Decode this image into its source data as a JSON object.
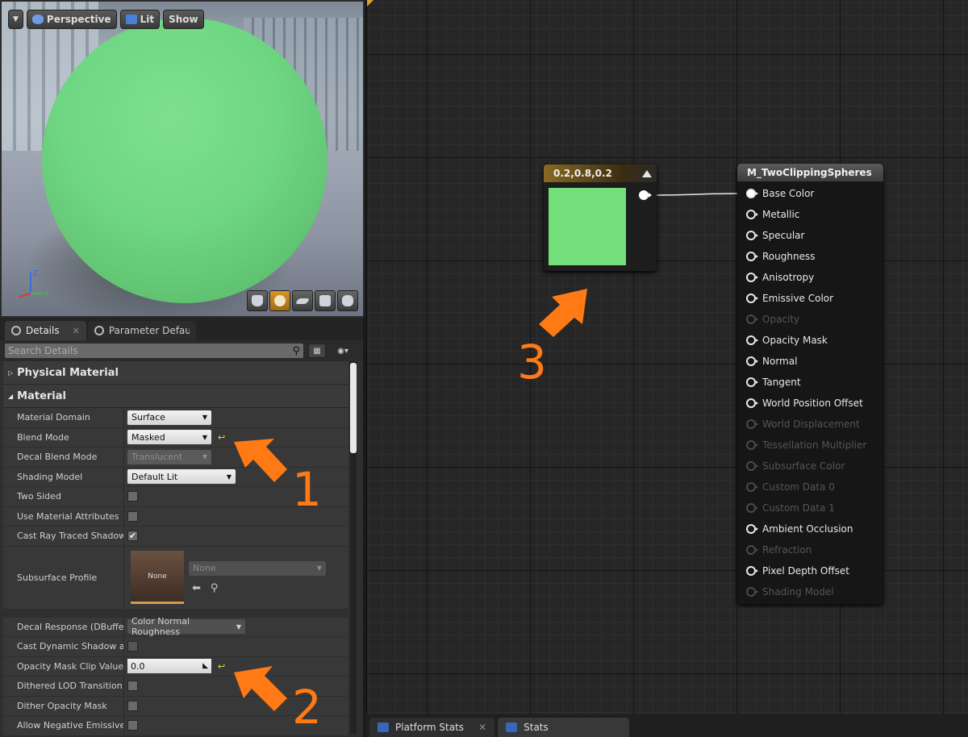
{
  "viewport": {
    "menu_icon": "chevron-down-icon",
    "perspective_label": "Perspective",
    "lit_label": "Lit",
    "show_label": "Show",
    "axis_z": "Z",
    "axis_y": "Y",
    "preview_color": "#6fd682"
  },
  "details": {
    "tabs": [
      {
        "label": "Details"
      },
      {
        "label": "Parameter Defaults"
      }
    ],
    "search_placeholder": "Search Details",
    "categories": {
      "physical_material": "Physical Material",
      "material": "Material"
    },
    "properties": {
      "material_domain": {
        "label": "Material Domain",
        "value": "Surface"
      },
      "blend_mode": {
        "label": "Blend Mode",
        "value": "Masked"
      },
      "decal_blend_mode": {
        "label": "Decal Blend Mode",
        "value": "Translucent"
      },
      "shading_model": {
        "label": "Shading Model",
        "value": "Default Lit"
      },
      "two_sided": {
        "label": "Two Sided",
        "checked": false
      },
      "use_material_attributes": {
        "label": "Use Material Attributes",
        "checked": false
      },
      "cast_ray_traced_shadows": {
        "label": "Cast Ray Traced Shadows",
        "checked": true,
        "mark": "✔"
      },
      "subsurface_profile": {
        "label": "Subsurface Profile",
        "thumb_text": "None",
        "value": "None"
      },
      "decal_response": {
        "label": "Decal Response (DBuffer)",
        "value": "Color Normal Roughness"
      },
      "cast_dynamic_shadow": {
        "label": "Cast Dynamic Shadow as M",
        "checked": false
      },
      "opacity_mask_clip_value": {
        "label": "Opacity Mask Clip Value",
        "value": "0.0"
      },
      "dithered_lod_transition": {
        "label": "Dithered LOD Transition",
        "checked": false
      },
      "dither_opacity_mask": {
        "label": "Dither Opacity Mask",
        "checked": false
      },
      "allow_negative_emissive": {
        "label": "Allow Negative Emissive C",
        "checked": false
      }
    }
  },
  "graph": {
    "constant_node": {
      "title": "0.2,0.8,0.2",
      "color": "#74e07b"
    },
    "material_node": {
      "title": "M_TwoClippingSpheres",
      "pins": [
        {
          "label": "Base Color",
          "enabled": true,
          "connected": true
        },
        {
          "label": "Metallic",
          "enabled": true
        },
        {
          "label": "Specular",
          "enabled": true
        },
        {
          "label": "Roughness",
          "enabled": true
        },
        {
          "label": "Anisotropy",
          "enabled": true
        },
        {
          "label": "Emissive Color",
          "enabled": true
        },
        {
          "label": "Opacity",
          "enabled": false
        },
        {
          "label": "Opacity Mask",
          "enabled": true
        },
        {
          "label": "Normal",
          "enabled": true
        },
        {
          "label": "Tangent",
          "enabled": true
        },
        {
          "label": "World Position Offset",
          "enabled": true
        },
        {
          "label": "World Displacement",
          "enabled": false
        },
        {
          "label": "Tessellation Multiplier",
          "enabled": false
        },
        {
          "label": "Subsurface Color",
          "enabled": false
        },
        {
          "label": "Custom Data 0",
          "enabled": false
        },
        {
          "label": "Custom Data 1",
          "enabled": false
        },
        {
          "label": "Ambient Occlusion",
          "enabled": true
        },
        {
          "label": "Refraction",
          "enabled": false
        },
        {
          "label": "Pixel Depth Offset",
          "enabled": true
        },
        {
          "label": "Shading Model",
          "enabled": false
        }
      ]
    }
  },
  "bottom_tabs": [
    {
      "label": "Platform Stats"
    },
    {
      "label": "Stats"
    }
  ],
  "annotations": {
    "color": "#ff7a14",
    "labels": [
      "1",
      "2",
      "3"
    ]
  }
}
